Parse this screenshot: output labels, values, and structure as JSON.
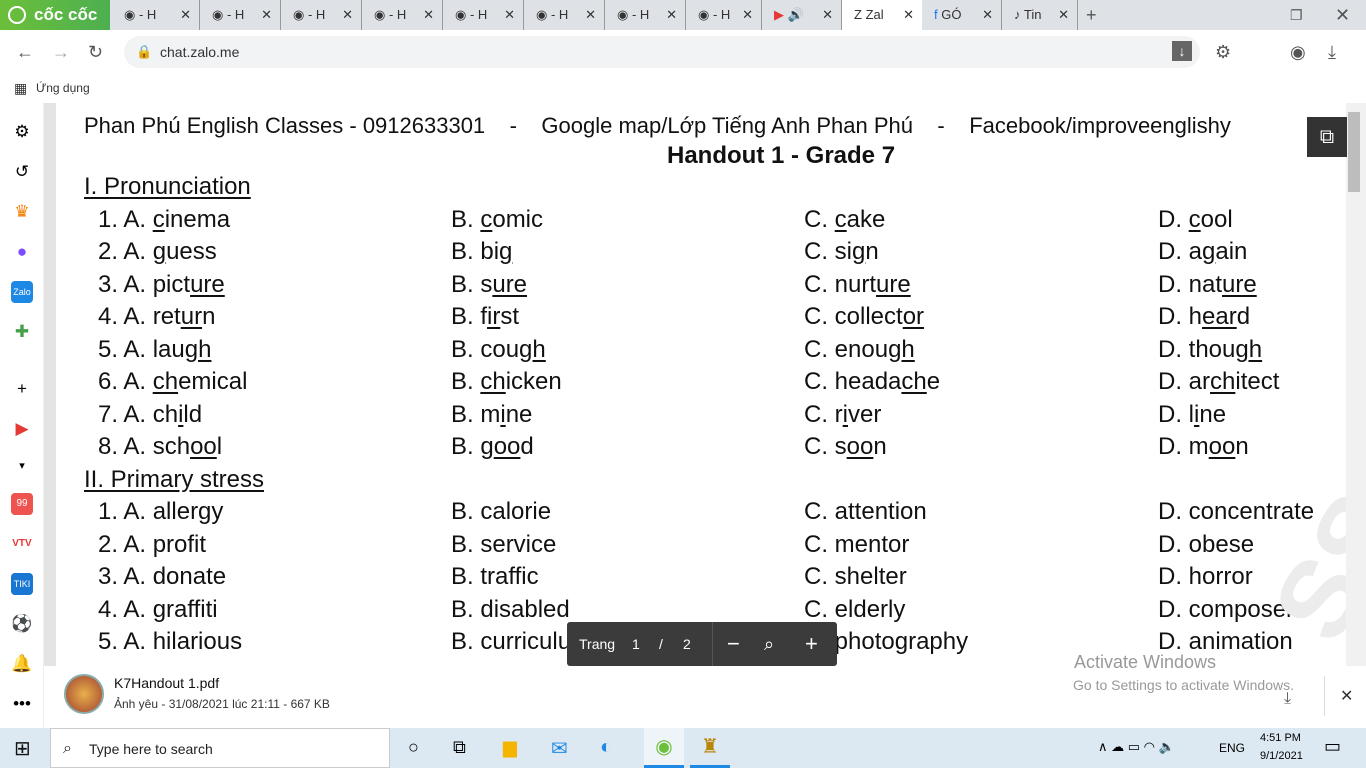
{
  "browser": {
    "brand": "cốc cốc",
    "tabs": [
      "- H",
      "- H",
      "- H",
      "- H",
      "- H",
      "- H",
      "- H",
      "- H",
      "",
      "Zal",
      "GÓ",
      "Tin"
    ],
    "url": "chat.zalo.me",
    "bookmark": "Ứng dụng"
  },
  "header": {
    "contact": "Phan Phú English Classes - 0912633301    -    Google map/Lớp Tiếng Anh Phan Phú    -    Facebook/improveenglishy",
    "title": "Handout 1 - Grade 7"
  },
  "sections": [
    {
      "heading": "I. Pronunciation",
      "rows": [
        [
          [
            "1. A. ",
            "c",
            "inema"
          ],
          [
            "B. ",
            "c",
            "omic"
          ],
          [
            "C. ",
            "c",
            "ake"
          ],
          [
            "D. ",
            "c",
            "ool"
          ]
        ],
        [
          [
            "2. A. ",
            "g",
            "uess"
          ],
          [
            "B. bi",
            "g",
            ""
          ],
          [
            "C. si",
            "g",
            "n"
          ],
          [
            "D. a",
            "g",
            "ain"
          ]
        ],
        [
          [
            "3. A. pict",
            "ure",
            ""
          ],
          [
            "B. s",
            "ure",
            ""
          ],
          [
            "C. nurt",
            "ure",
            ""
          ],
          [
            "D. nat",
            "ure",
            ""
          ]
        ],
        [
          [
            "4. A. ret",
            "ur",
            "n"
          ],
          [
            "B. f",
            "ir",
            "st"
          ],
          [
            "C. collect",
            "or",
            ""
          ],
          [
            "D. h",
            "ear",
            "d"
          ]
        ],
        [
          [
            "5. A. lau",
            "gh",
            ""
          ],
          [
            "B. cou",
            "gh",
            ""
          ],
          [
            "C. enou",
            "gh",
            ""
          ],
          [
            "D. thou",
            "gh",
            ""
          ]
        ],
        [
          [
            "6. A. ",
            "ch",
            "emical"
          ],
          [
            "B. ",
            "ch",
            "icken"
          ],
          [
            "C. heada",
            "ch",
            "e"
          ],
          [
            "D. ar",
            "ch",
            "itect"
          ]
        ],
        [
          [
            "7. A. ch",
            "i",
            "ld"
          ],
          [
            "B. m",
            "i",
            "ne"
          ],
          [
            "C. r",
            "i",
            "ver"
          ],
          [
            "D. l",
            "i",
            "ne"
          ]
        ],
        [
          [
            "8. A. sch",
            "oo",
            "l"
          ],
          [
            "B. g",
            "oo",
            "d"
          ],
          [
            "C. s",
            "oo",
            "n"
          ],
          [
            "D. m",
            "oo",
            "n"
          ]
        ]
      ]
    },
    {
      "heading": "II. Primary stress",
      "rows": [
        [
          [
            "1. A. allergy",
            "",
            ""
          ],
          [
            "B. calorie",
            "",
            ""
          ],
          [
            "C. attention",
            "",
            ""
          ],
          [
            "D. concentrate",
            "",
            ""
          ]
        ],
        [
          [
            "2. A. profit",
            "",
            ""
          ],
          [
            "B. service",
            "",
            ""
          ],
          [
            "C. mentor",
            "",
            ""
          ],
          [
            "D. obese",
            "",
            ""
          ]
        ],
        [
          [
            "3. A. donate",
            "",
            ""
          ],
          [
            "B. traffic",
            "",
            ""
          ],
          [
            "C. shelter",
            "",
            ""
          ],
          [
            "D. horror",
            "",
            ""
          ]
        ],
        [
          [
            "4. A. graffiti",
            "",
            ""
          ],
          [
            "B. disabled",
            "",
            ""
          ],
          [
            "C. elderly",
            "",
            ""
          ],
          [
            "D. composer",
            "",
            ""
          ]
        ],
        [
          [
            "5. A. hilarious",
            "",
            ""
          ],
          [
            "B. curriculum",
            "",
            ""
          ],
          [
            "C. photography",
            "",
            ""
          ],
          [
            "D. animation",
            "",
            ""
          ]
        ]
      ]
    }
  ],
  "pdf_toolbar": {
    "label": "Trang",
    "page": "1",
    "sep": "/",
    "total": "2"
  },
  "file": {
    "name": "K7Handout 1.pdf",
    "meta": "Ảnh yêu - 31/08/2021 lúc 21:11 - 667 KB"
  },
  "watermark": {
    "line1": "Activate Windows",
    "line2": "Go to Settings to activate Windows."
  },
  "taskbar": {
    "search_placeholder": "Type here to search",
    "lang": "ENG",
    "time": "4:51 PM",
    "date": "9/1/2021"
  }
}
